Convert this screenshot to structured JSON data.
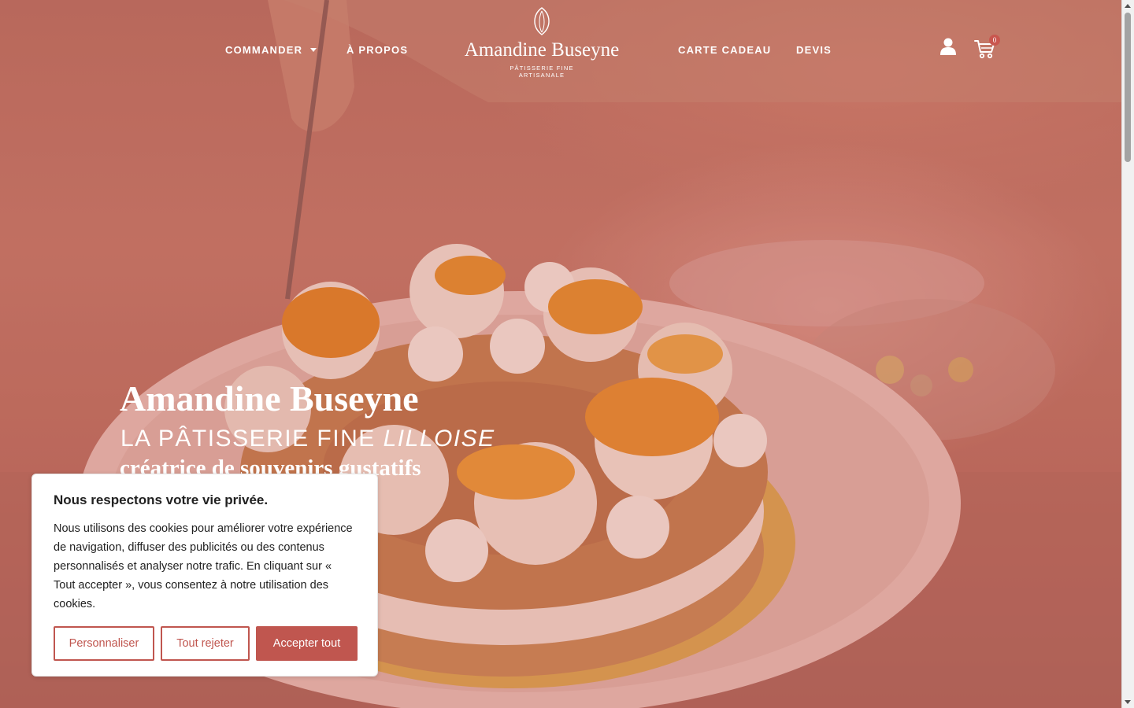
{
  "header": {
    "nav_left": [
      {
        "label": "COMMANDER",
        "has_dropdown": true
      },
      {
        "label": "À PROPOS"
      }
    ],
    "logo": {
      "name": "Amandine Buseyne",
      "tagline_line1": "PÂTISSERIE FINE",
      "tagline_line2": "ARTISANALE"
    },
    "nav_right": [
      {
        "label": "CARTE CADEAU"
      },
      {
        "label": "DEVIS"
      }
    ],
    "account_icon": "user-icon",
    "cart_icon": "cart-icon",
    "cart_count": "0"
  },
  "hero": {
    "title": "Amandine Buseyne",
    "subtitle_prefix": "LA PÂTISSERIE FINE ",
    "subtitle_emphasis": "LILLOISE",
    "tagline": "créatrice de souvenirs gustatifs"
  },
  "cookie_banner": {
    "title": "Nous respectons votre vie privée.",
    "text": "Nous utilisons des cookies pour améliorer votre expérience de navigation, diffuser des publicités ou des contenus personnalisés et analyser notre trafic. En cliquant sur « Tout accepter », vous consentez à notre utilisation des cookies.",
    "buttons": {
      "customize": "Personnaliser",
      "reject": "Tout rejeter",
      "accept": "Accepter tout"
    }
  },
  "colors": {
    "accent": "#c0564f",
    "overlay": "#b8695c",
    "text_light": "#ffffff"
  }
}
